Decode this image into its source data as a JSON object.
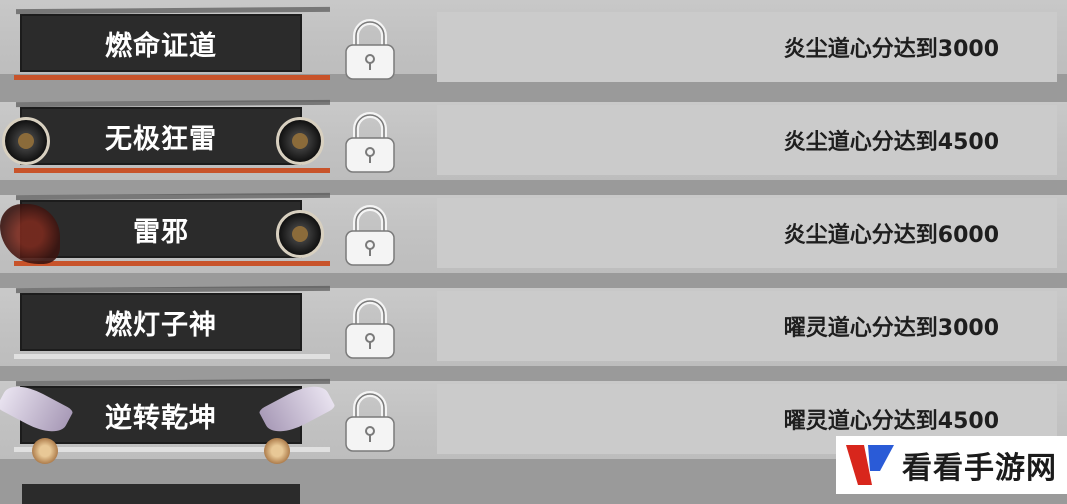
{
  "achievements": [
    {
      "title": "燃命证道",
      "requirement": "炎尘道心分达到3000",
      "decor": "plain-red"
    },
    {
      "title": "无极狂雷",
      "requirement": "炎尘道心分达到4500",
      "decor": "badges"
    },
    {
      "title": "雷邪",
      "requirement": "炎尘道心分达到6000",
      "decor": "red-ornament"
    },
    {
      "title": "燃灯子神",
      "requirement": "曜灵道心分达到3000",
      "decor": "plain-silver"
    },
    {
      "title": "逆转乾坤",
      "requirement": "曜灵道心分达到4500",
      "decor": "feathers"
    }
  ],
  "lock_icon": "padlock-icon",
  "watermark": {
    "text": "看看手游网",
    "logo": "kk-logo"
  }
}
